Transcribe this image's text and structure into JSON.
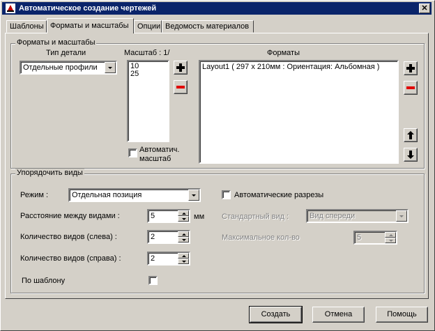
{
  "window": {
    "title": "Автоматическое создание чертежей",
    "close": "✕"
  },
  "tabs": [
    "Шаблоны",
    "Форматы и масштабы",
    "Опции",
    "Ведомость материалов"
  ],
  "formats_group": {
    "title": "Форматы и масштабы",
    "part_type_label": "Тип детали",
    "part_type_value": "Отдельные профили",
    "scale_label": "Масштаб : 1/",
    "scales": [
      "10",
      "25"
    ],
    "auto_scale_label_1": "Автоматич.",
    "auto_scale_label_2": "масштаб",
    "formats_label": "Форматы",
    "formats": [
      "Layout1 ( 297 x 210мм : Ориентация: Альбомная )"
    ]
  },
  "views_group": {
    "title": "Упорядочить виды",
    "mode_label": "Режим :",
    "mode_value": "Отдельная позиция",
    "distance_label": "Расстояние между видами :",
    "distance_value": "5",
    "distance_unit": "мм",
    "left_count_label": "Количество видов (слева) :",
    "left_count_value": "2",
    "right_count_label": "Количество видов (справа) :",
    "right_count_value": "2",
    "template_label": "По шаблону",
    "auto_sections_label": "Автоматические разрезы",
    "standard_view_label": "Стандартный вид :",
    "standard_view_value": "Вид спереди",
    "max_count_label": "Максимальное кол-во",
    "max_count_value": "5"
  },
  "buttons": {
    "create": "Создать",
    "cancel": "Отмена",
    "help": "Помощь"
  }
}
